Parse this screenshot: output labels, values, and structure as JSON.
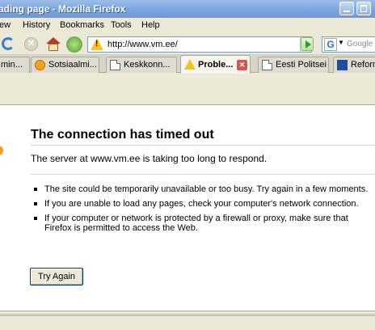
{
  "window": {
    "title": "ading page - Mozilla Firefox"
  },
  "menu": [
    "ew",
    "History",
    "Bookmarks",
    "Tools",
    "Help"
  ],
  "address": {
    "url": "http://www.vm.ee/"
  },
  "search": {
    "placeholder": "Google"
  },
  "tabs": [
    {
      "label": "min...",
      "active": false
    },
    {
      "label": "Sotsiaalmi...",
      "active": false
    },
    {
      "label": "Keskkonn...",
      "active": false
    },
    {
      "label": "Proble...",
      "active": true
    },
    {
      "label": "Eesti Politsei",
      "active": false
    },
    {
      "label": "Reform",
      "active": false
    }
  ],
  "error": {
    "title": "The connection has timed out",
    "description": "The server at www.vm.ee is taking too long to respond.",
    "tips": [
      "The site could be temporarily unavailable or too busy. Try again in a few moments.",
      "If you are unable to load any pages, check your computer's network connection.",
      "If your computer or network is protected by a firewall or proxy, make sure that Firefox is permitted to access the Web."
    ],
    "button": "Try Again"
  }
}
